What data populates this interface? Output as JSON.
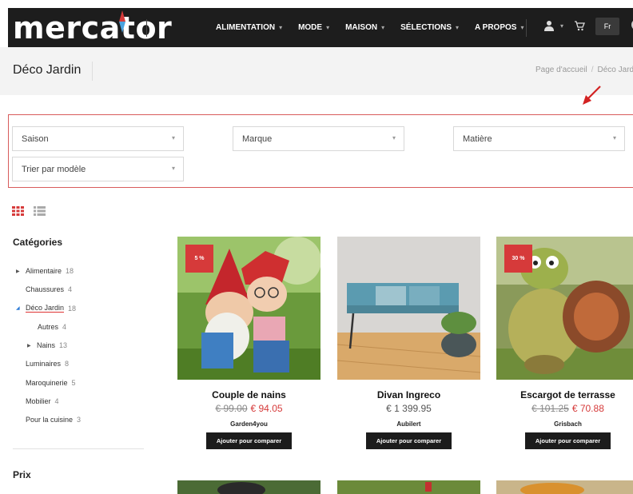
{
  "header": {
    "logo": "mercator",
    "nav": [
      {
        "label": "ALIMENTATION"
      },
      {
        "label": "MODE"
      },
      {
        "label": "MAISON"
      },
      {
        "label": "SÉLECTIONS"
      },
      {
        "label": "A PROPOS"
      }
    ],
    "language": "Fr"
  },
  "page": {
    "title": "Déco Jardin",
    "breadcrumb": [
      "Page d'accueil",
      "Déco Jardin"
    ]
  },
  "filters": {
    "selects": [
      "Saison",
      "Marque",
      "Matière",
      "Trier par modèle"
    ]
  },
  "sidebar": {
    "categories_title": "Catégories",
    "categories": [
      {
        "label": "Alimentaire",
        "count": "18",
        "expand": true
      },
      {
        "label": "Chaussures",
        "count": "4",
        "expand": false
      },
      {
        "label": "Déco Jardin",
        "count": "18",
        "expand": true,
        "active": true
      },
      {
        "label": "Autres",
        "count": "4",
        "expand": false
      },
      {
        "label": "Nains",
        "count": "13",
        "expand": true
      },
      {
        "label": "Luminaires",
        "count": "8",
        "expand": false
      },
      {
        "label": "Maroquinerie",
        "count": "5",
        "expand": false
      },
      {
        "label": "Mobilier",
        "count": "4",
        "expand": false
      },
      {
        "label": "Pour la cuisine",
        "count": "3",
        "expand": false
      }
    ],
    "price_title": "Prix"
  },
  "products": [
    {
      "name": "Couple de nains",
      "badge": "5 %",
      "old_price": "€ 99.00",
      "price": "€ 94.05",
      "brand": "Garden4you",
      "button": "Ajouter pour comparer"
    },
    {
      "name": "Divan Ingreco",
      "badge": "",
      "old_price": "",
      "price": "€ 1 399.95",
      "brand": "Aubilert",
      "button": "Ajouter pour comparer"
    },
    {
      "name": "Escargot de terrasse",
      "badge": "30 %",
      "old_price": "€ 101.25",
      "price": "€ 70.88",
      "brand": "Grisbach",
      "button": "Ajouter pour comparer"
    }
  ],
  "colors": {
    "header_bg": "#1d1d1d",
    "accent": "#d63a3a",
    "button_bg": "#1c1c1c"
  }
}
